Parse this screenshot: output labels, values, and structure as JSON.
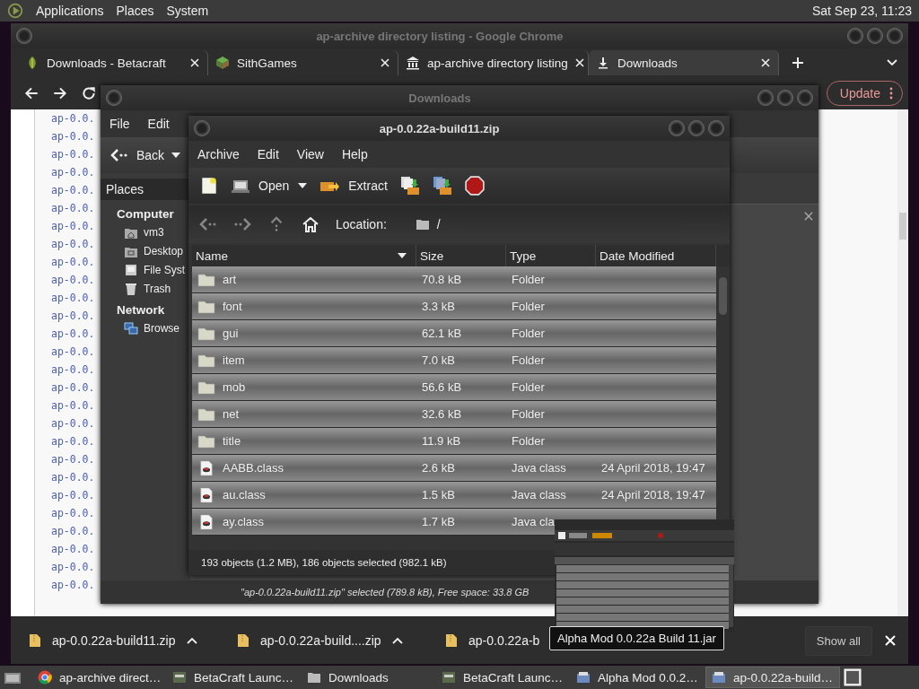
{
  "top_panel": {
    "menus": [
      "Applications",
      "Places",
      "System"
    ],
    "clock": "Sat Sep 23, 11:23"
  },
  "browser": {
    "title": "ap-archive directory listing - Google Chrome",
    "tabs": [
      {
        "label": "Downloads - Betacraft",
        "kind": "leaf",
        "selected": false
      },
      {
        "label": "SithGames",
        "kind": "cube",
        "selected": false
      },
      {
        "label": "ap-archive directory listing",
        "kind": "bank",
        "selected": false
      },
      {
        "label": "Downloads",
        "kind": "download",
        "selected": true
      }
    ],
    "update_button": "Update",
    "listing": [
      "ap-0.0.",
      "ap-0.0.",
      "ap-0.0.",
      "ap-0.0.",
      "ap-0.0.",
      "ap-0.0.",
      "ap-0.0.",
      "ap-0.0.",
      "ap-0.0.",
      "ap-0.0.",
      "ap-0.0.",
      "ap-0.0.",
      "ap-0.0.",
      "ap-0.0.",
      "ap-0.0.",
      "ap-0.0.",
      "ap-0.0.",
      "ap-0.0.",
      "ap-0.0.",
      "ap-0.0.",
      "ap-0.0.",
      "ap-0.0.",
      "ap-0.0.",
      "ap-0.0.",
      "ap-0.0.",
      "ap-0.0.",
      "ap-0.0."
    ],
    "downloads": [
      "ap-0.0.22a-build11.zip",
      "ap-0.0.22a-build....zip",
      "ap-0.0.22a-b"
    ],
    "show_all": "Show all"
  },
  "file_manager": {
    "title": "Downloads",
    "menus": [
      "File",
      "Edit"
    ],
    "back": "Back",
    "places_header": "Places",
    "sections": [
      {
        "heading": "Computer",
        "items": [
          {
            "label": "vm3",
            "kind": "home"
          },
          {
            "label": "Desktop",
            "kind": "desktop"
          },
          {
            "label": "File Syst",
            "kind": "drive"
          },
          {
            "label": "Trash",
            "kind": "trash"
          }
        ]
      },
      {
        "heading": "Network",
        "items": [
          {
            "label": "Browse",
            "kind": "network"
          }
        ]
      }
    ],
    "status": "\"ap-0.0.22a-build11.zip\" selected (789.8 kB), Free space: 33.8 GB"
  },
  "archive": {
    "title": "ap-0.0.22a-build11.zip",
    "menus": [
      "Archive",
      "Edit",
      "View",
      "Help"
    ],
    "open": "Open",
    "extract": "Extract",
    "location_label": "Location:",
    "location": "/",
    "columns": [
      "Name",
      "Size",
      "Type",
      "Date Modified"
    ],
    "rows": [
      {
        "name": "art",
        "size": "70.8 kB",
        "type": "Folder",
        "kind": "folder",
        "selected": true
      },
      {
        "name": "font",
        "size": "3.3 kB",
        "type": "Folder",
        "kind": "folder",
        "selected": true
      },
      {
        "name": "gui",
        "size": "62.1 kB",
        "type": "Folder",
        "kind": "folder",
        "selected": true
      },
      {
        "name": "item",
        "size": "7.0 kB",
        "type": "Folder",
        "kind": "folder",
        "selected": true
      },
      {
        "name": "mob",
        "size": "56.6 kB",
        "type": "Folder",
        "kind": "folder",
        "selected": true
      },
      {
        "name": "net",
        "size": "32.6 kB",
        "type": "Folder",
        "kind": "folder",
        "selected": true
      },
      {
        "name": "title",
        "size": "11.9 kB",
        "type": "Folder",
        "kind": "folder",
        "selected": true
      },
      {
        "name": "AABB.class",
        "size": "2.6 kB",
        "type": "Java class",
        "date": "24 April 2018, 19:47",
        "kind": "class",
        "selected": true
      },
      {
        "name": "au.class",
        "size": "1.5 kB",
        "type": "Java class",
        "date": "24 April 2018, 19:47",
        "kind": "class",
        "selected": true
      },
      {
        "name": "ay.class",
        "size": "1.7 kB",
        "type": "Java cla",
        "kind": "class",
        "selected": true
      }
    ],
    "status": "193 objects (1.2 MB), 186 objects selected (982.1 kB)"
  },
  "tooltip": "Alpha Mod 0.0.22a Build 11.jar",
  "taskbar": {
    "items": [
      {
        "label": "ap-archive direct…",
        "kind": "chrome",
        "selected": false
      },
      {
        "label": "BetaCraft Launc…",
        "kind": "app",
        "selected": false
      },
      {
        "label": "Downloads",
        "kind": "folder",
        "selected": false
      },
      {
        "label": "BetaCraft Launc…",
        "kind": "app",
        "selected": false
      },
      {
        "label": "Alpha Mod 0.0.2…",
        "kind": "archive",
        "selected": false
      },
      {
        "label": "ap-0.0.22a-build…",
        "kind": "archive",
        "selected": true
      }
    ]
  }
}
